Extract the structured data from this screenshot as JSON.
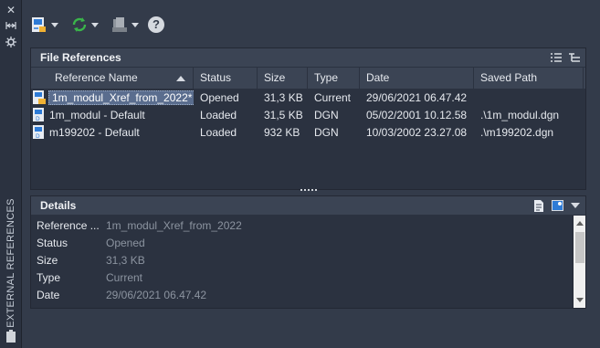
{
  "palette": {
    "title": "EXTERNAL REFERENCES"
  },
  "toolbar": {
    "attach_icon": "attach-dwg-icon",
    "refresh_icon": "refresh-icon",
    "change_path_icon": "change-path-icon",
    "help_label": "?"
  },
  "file_references": {
    "title": "File References",
    "columns": [
      "Reference Name",
      "Status",
      "Size",
      "Type",
      "Date",
      "Saved Path"
    ],
    "sort_column": "Reference Name",
    "rows": [
      {
        "name": "1m_modul_Xref_from_2022*",
        "status": "Opened",
        "size": "31,3 KB",
        "type": "Current",
        "date": "29/06/2021 06.47.42",
        "saved_path": "",
        "icon": "dwg-file-icon",
        "selected": true
      },
      {
        "name": "1m_modul - Default",
        "status": "Loaded",
        "size": "31,5 KB",
        "type": "DGN",
        "date": "05/02/2001 10.12.58",
        "saved_path": ".\\1m_modul.dgn",
        "icon": "dgn-file-icon",
        "selected": false
      },
      {
        "name": "m199202 - Default",
        "status": "Loaded",
        "size": "932 KB",
        "type": "DGN",
        "date": "10/03/2002 23.27.08",
        "saved_path": ".\\m199202.dgn",
        "icon": "dgn-file-icon",
        "selected": false
      }
    ]
  },
  "details": {
    "title": "Details",
    "fields": [
      {
        "key": "Reference ...",
        "value": "1m_modul_Xref_from_2022"
      },
      {
        "key": "Status",
        "value": "Opened"
      },
      {
        "key": "Size",
        "value": "31,3 KB"
      },
      {
        "key": "Type",
        "value": "Current"
      },
      {
        "key": "Date",
        "value": "29/06/2021 06.47.42"
      }
    ]
  },
  "colors": {
    "selection": "#5a6d8e",
    "panel_bg": "#2b3240",
    "header_bg": "#3b4454",
    "refresh_green": "#3ab54a"
  }
}
